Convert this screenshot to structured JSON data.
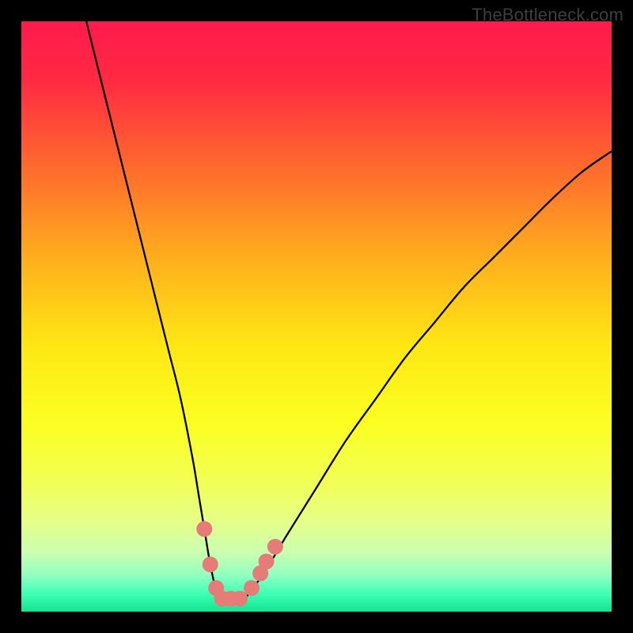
{
  "watermark": {
    "text": "TheBottleneck.com"
  },
  "chart_data": {
    "type": "line",
    "title": "",
    "xlabel": "",
    "ylabel": "",
    "xlim": [
      0,
      100
    ],
    "ylim": [
      0,
      100
    ],
    "grid": false,
    "series": [
      {
        "name": "curve",
        "x": [
          11,
          13,
          15,
          17,
          19,
          21,
          23,
          25,
          27,
          29,
          30,
          31,
          32,
          33,
          33.5,
          34,
          35,
          36,
          37,
          38,
          39,
          40,
          42,
          45,
          50,
          55,
          60,
          65,
          70,
          75,
          80,
          85,
          90,
          95,
          100
        ],
        "y": [
          100,
          92,
          84,
          76,
          68,
          60,
          52,
          44,
          36,
          26,
          20,
          14,
          8,
          3.5,
          2,
          2,
          2,
          2,
          2,
          2.5,
          3.5,
          5,
          8,
          13,
          21,
          29,
          36,
          43,
          49,
          55,
          60,
          65,
          70,
          74.5,
          78
        ]
      }
    ],
    "markers": [
      {
        "x": 31.0,
        "y": 14.0
      },
      {
        "x": 32.0,
        "y": 8.0
      },
      {
        "x": 33.0,
        "y": 4.0
      },
      {
        "x": 34.0,
        "y": 2.2
      },
      {
        "x": 35.5,
        "y": 2.2
      },
      {
        "x": 37.0,
        "y": 2.2
      },
      {
        "x": 39.0,
        "y": 4.0
      },
      {
        "x": 40.5,
        "y": 6.5
      },
      {
        "x": 41.5,
        "y": 8.5
      },
      {
        "x": 43.0,
        "y": 11.0
      }
    ],
    "gradient_stops": [
      {
        "pos": 0.0,
        "color": "#ff1a4d"
      },
      {
        "pos": 0.1,
        "color": "#ff2a42"
      },
      {
        "pos": 0.25,
        "color": "#ff6b2d"
      },
      {
        "pos": 0.4,
        "color": "#ffae1d"
      },
      {
        "pos": 0.55,
        "color": "#ffe714"
      },
      {
        "pos": 0.68,
        "color": "#fbff21"
      },
      {
        "pos": 0.78,
        "color": "#f2ff55"
      },
      {
        "pos": 0.85,
        "color": "#e5ff8a"
      },
      {
        "pos": 0.9,
        "color": "#caffb0"
      },
      {
        "pos": 0.94,
        "color": "#8dffc1"
      },
      {
        "pos": 0.97,
        "color": "#3dffb4"
      },
      {
        "pos": 1.0,
        "color": "#11e492"
      }
    ],
    "marker_color": "#e77b77",
    "marker_radius": 10
  }
}
